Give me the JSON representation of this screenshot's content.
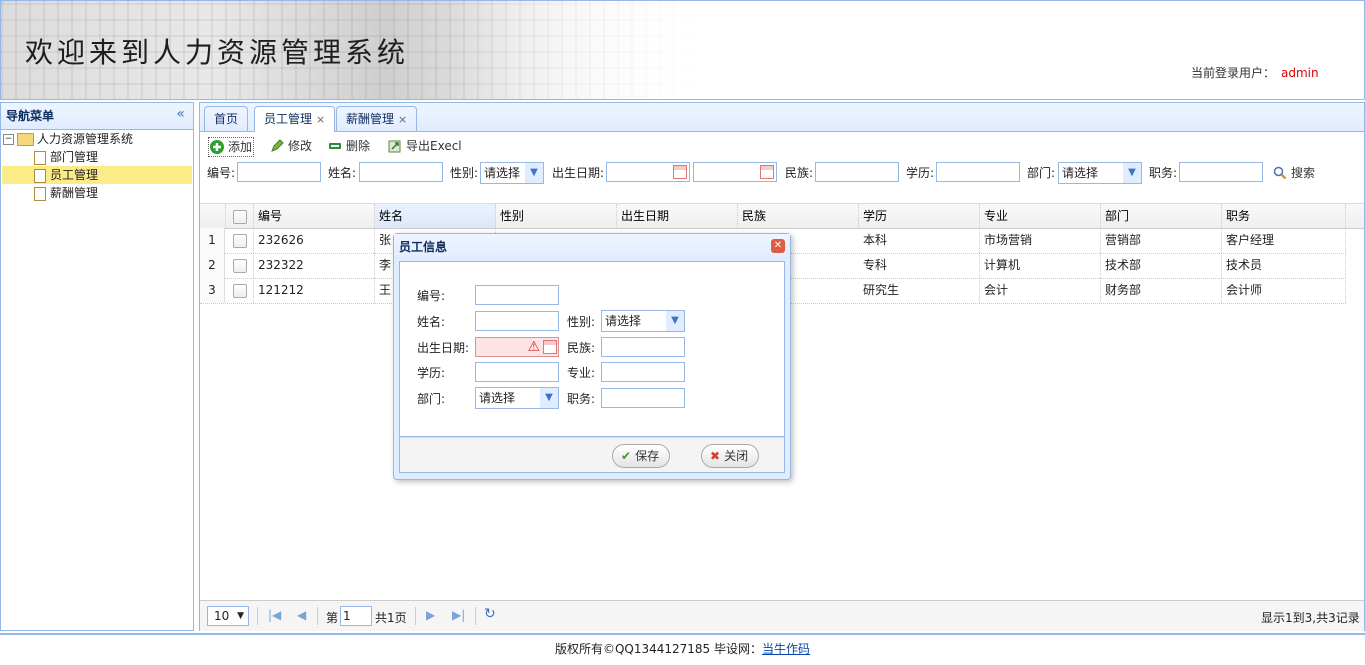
{
  "header": {
    "title": "欢迎来到人力资源管理系统",
    "login_label": "当前登录用户：",
    "login_user": "admin"
  },
  "sidebar": {
    "title": "导航菜单",
    "collapse_icon": "«",
    "root": "人力资源管理系统",
    "items": [
      {
        "label": "部门管理"
      },
      {
        "label": "员工管理",
        "selected": true
      },
      {
        "label": "薪酬管理"
      }
    ]
  },
  "tabs": [
    {
      "label": "首页",
      "closable": false
    },
    {
      "label": "员工管理",
      "closable": true,
      "active": true
    },
    {
      "label": "薪酬管理",
      "closable": true
    }
  ],
  "tab_close_glyph": "×",
  "toolbar": {
    "add": "添加",
    "edit": "修改",
    "delete": "删除",
    "export": "导出Execl"
  },
  "search": {
    "id_label": "编号:",
    "name_label": "姓名:",
    "gender_label": "性别:",
    "gender_value": "请选择",
    "birth_label": "出生日期:",
    "nation_label": "民族:",
    "education_label": "学历:",
    "dept_label": "部门:",
    "dept_value": "请选择",
    "position_label": "职务:",
    "search_button": "搜索"
  },
  "grid": {
    "columns": [
      "编号",
      "姓名",
      "性别",
      "出生日期",
      "民族",
      "学历",
      "专业",
      "部门",
      "职务"
    ],
    "rows": [
      {
        "num": "1",
        "id": "232626",
        "name": "张",
        "education": "本科",
        "major": "市场营销",
        "dept": "营销部",
        "position": "客户经理"
      },
      {
        "num": "2",
        "id": "232322",
        "name": "李",
        "education": "专科",
        "major": "计算机",
        "dept": "技术部",
        "position": "技术员"
      },
      {
        "num": "3",
        "id": "121212",
        "name": "王",
        "education": "研究生",
        "major": "会计",
        "dept": "财务部",
        "position": "会计师"
      }
    ]
  },
  "pager": {
    "page_size": "10",
    "page_prefix": "第",
    "page_number": "1",
    "page_suffix": "共1页",
    "summary": "显示1到3,共3记录"
  },
  "footer": {
    "text": "版权所有©QQ1344127185 毕设网：",
    "link": "当牛作码"
  },
  "dialog": {
    "title": "员工信息",
    "id_label": "编号:",
    "name_label": "姓名:",
    "gender_label": "性别:",
    "gender_value": "请选择",
    "birth_label": "出生日期:",
    "nation_label": "民族:",
    "education_label": "学历:",
    "major_label": "专业:",
    "dept_label": "部门:",
    "dept_value": "请选择",
    "position_label": "职务:",
    "save_button": "保存",
    "close_button": "关闭"
  },
  "colors": {
    "border": "#95b8e7",
    "panel_header": "#e0ecff",
    "selected_row": "#fbec88",
    "username": "#e10000"
  }
}
